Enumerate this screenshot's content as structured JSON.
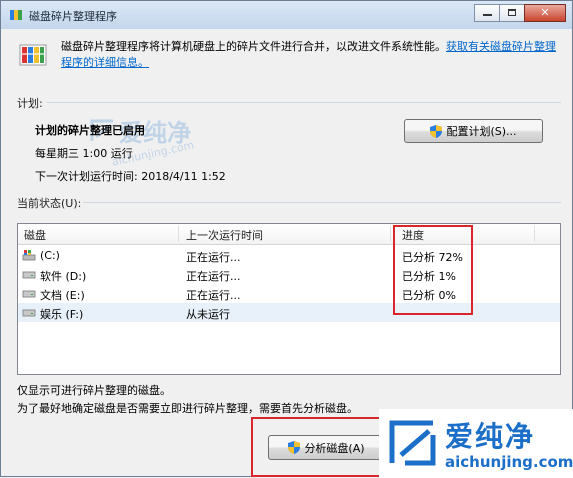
{
  "window": {
    "title": "磁盘碎片整理程序"
  },
  "header": {
    "description": "磁盘碎片整理程序将计算机硬盘上的碎片文件进行合并，以改进文件系统性能。",
    "help_link": "获取有关磁盘碎片整理程序的详细信息。"
  },
  "schedule": {
    "section_label": "计划:",
    "title": "计划的碎片整理已启用",
    "time": "每星期三 1:00 运行",
    "next_run": "下一次计划运行时间: 2018/4/11 1:52",
    "configure_button": "配置计划(S)..."
  },
  "status": {
    "section_label": "当前状态(U):",
    "columns": [
      "磁盘",
      "上一次运行时间",
      "进度"
    ],
    "rows": [
      {
        "disk": "(C:)",
        "last_run": "正在运行...",
        "progress": "已分析 72%"
      },
      {
        "disk": "软件 (D:)",
        "last_run": "正在运行...",
        "progress": "已分析 1%"
      },
      {
        "disk": "文档 (E:)",
        "last_run": "正在运行...",
        "progress": "已分析 0%"
      },
      {
        "disk": "娱乐 (F:)",
        "last_run": "从未运行",
        "progress": ""
      }
    ]
  },
  "footer": {
    "note1": "仅显示可进行碎片整理的磁盘。",
    "note2": "为了最好地确定磁盘是否需要立即进行碎片整理，需要首先分析磁盘。",
    "analyze_button": "分析磁盘(A)"
  },
  "watermark": {
    "name": "爱纯净",
    "url": "aichunjing.com"
  },
  "colors": {
    "accent": "#0066cc",
    "highlight_box": "#d8262c",
    "watermark": "#1c6fc9"
  }
}
